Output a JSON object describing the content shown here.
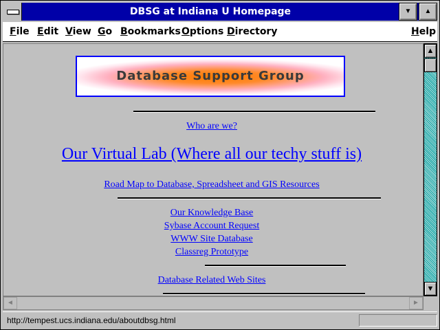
{
  "window": {
    "title": "DBSG at Indiana U Homepage"
  },
  "menubar": {
    "items": [
      "File",
      "Edit",
      "View",
      "Go",
      "Bookmarks",
      "Options",
      "Directory",
      "Help"
    ]
  },
  "page": {
    "banner_text": "Database Support Group",
    "links": [
      "Who are we?",
      "Our Virtual Lab (Where all our techy stuff is)",
      "Road Map to Database, Spreadsheet and GIS Resources",
      "Our Knowledge Base",
      "Sybase Account Request",
      "WWW Site Database",
      "Classreg Prototype",
      "Database Related Web Sites"
    ]
  },
  "status": {
    "url": "http://tempest.ucs.indiana.edu/aboutdbsg.html"
  },
  "icons": {
    "up": "▲",
    "down": "▼",
    "left": "◄",
    "right": "►",
    "minimize": "▼",
    "maximize": "▲"
  }
}
